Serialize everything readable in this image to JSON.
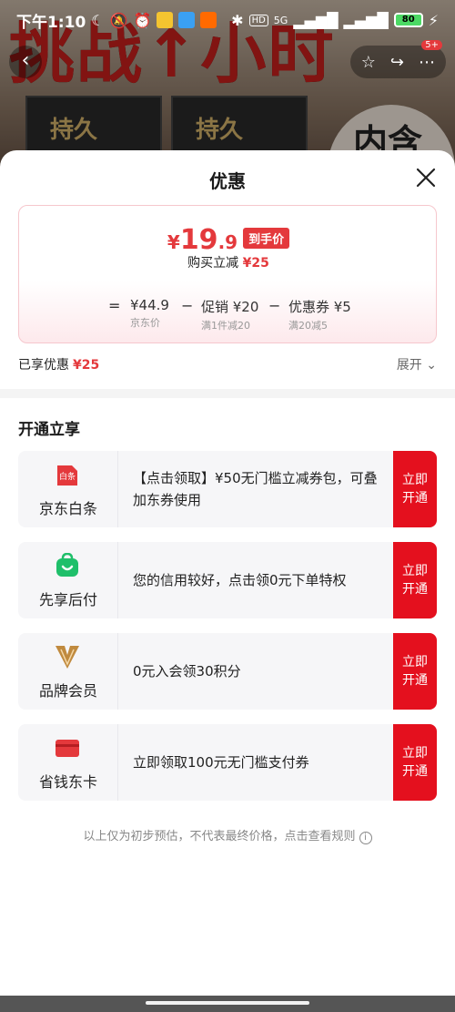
{
  "status_bar": {
    "time": "下午1:10",
    "network": "5G",
    "hd": "HD",
    "battery": "80"
  },
  "background": {
    "banner_text": "挑战↑小时",
    "box_text": "持久",
    "circle_text": "内含"
  },
  "nav": {
    "back_icon": "chevron-left-icon",
    "badge": "5+"
  },
  "sheet": {
    "title": "优惠",
    "close_icon": "close-icon"
  },
  "price": {
    "currency": "¥",
    "integer": "19",
    "decimal": ".9",
    "final_label": "到手价",
    "reduce_label": "购买立减",
    "reduce_amount": "¥25",
    "breakdown": {
      "eq": "=",
      "base_value": "¥44.9",
      "base_label": "京东价",
      "minus1": "−",
      "promo_value": "促销 ¥20",
      "promo_label": "满1件减20",
      "minus2": "−",
      "coupon_value": "优惠券 ¥5",
      "coupon_label": "满20减5"
    }
  },
  "saved": {
    "label": "已享优惠",
    "amount": "¥25",
    "expand": "展开 ⌄"
  },
  "section": {
    "title": "开通立享"
  },
  "offers": [
    {
      "name": "京东白条",
      "desc": "【点击领取】¥50无门槛立减券包，可叠加东券使用",
      "button": "立即开通",
      "logo_color": "#e4393c",
      "icon": "jd-baitiao-icon",
      "logo_text": "白条"
    },
    {
      "name": "先享后付",
      "desc": "您的信用较好，点击领0元下单特权",
      "button": "立即开通",
      "logo_color": "#1fbf6a",
      "icon": "shopping-bag-icon"
    },
    {
      "name": "品牌会员",
      "desc": "0元入会领30积分",
      "button": "立即开通",
      "logo_color": "#c08a3e",
      "icon": "brand-v-icon"
    },
    {
      "name": "省钱东卡",
      "desc": "立即领取100元无门槛支付券",
      "button": "立即开通",
      "logo_color": "#e4393c",
      "icon": "card-icon"
    }
  ],
  "footer": {
    "note": "以上仅为初步预估，不代表最终价格，点击查看规则",
    "info_icon": "i"
  },
  "colors": {
    "accent": "#e4393c",
    "button": "#e4101e"
  }
}
